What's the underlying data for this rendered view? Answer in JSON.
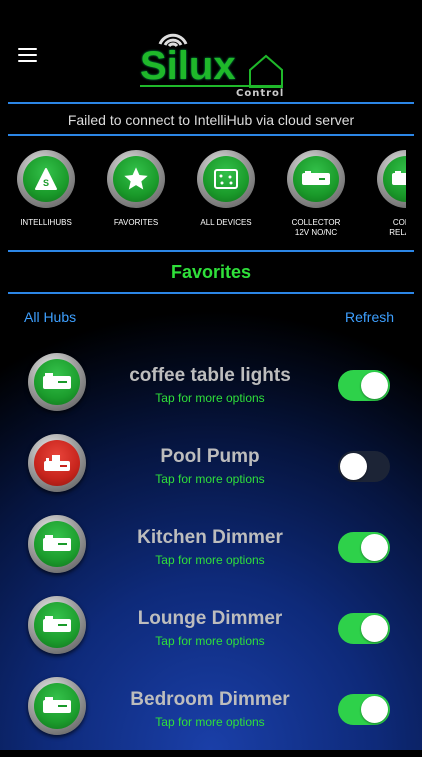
{
  "header": {
    "logo_word": "Silux",
    "logo_sub": "Control",
    "status_message": "Failed to connect to IntelliHub via cloud server"
  },
  "categories": [
    {
      "label": "INTELLIHUBS",
      "icon": "intellihub-icon"
    },
    {
      "label": "FAVORITES",
      "icon": "star-icon"
    },
    {
      "label": "ALL DEVICES",
      "icon": "all-devices-icon"
    },
    {
      "label": "COLLECTOR\n12V NO/NC",
      "icon": "collector-device-icon"
    },
    {
      "label": "COLLE\nRELAY C",
      "icon": "relay-device-icon"
    }
  ],
  "favorites": {
    "title": "Favorites",
    "all_hubs": "All Hubs",
    "refresh": "Refresh"
  },
  "devices": [
    {
      "name": "coffee table lights",
      "sub": "Tap for more options",
      "on": true,
      "state_color": "green",
      "icon": "dimmer-device-icon"
    },
    {
      "name": "Pool Pump",
      "sub": "Tap for more options",
      "on": false,
      "state_color": "red",
      "icon": "pump-device-icon"
    },
    {
      "name": "Kitchen Dimmer",
      "sub": "Tap for more options",
      "on": true,
      "state_color": "green",
      "icon": "dimmer-device-icon"
    },
    {
      "name": "Lounge Dimmer",
      "sub": "Tap for more options",
      "on": true,
      "state_color": "green",
      "icon": "dimmer-device-icon"
    },
    {
      "name": "Bedroom Dimmer",
      "sub": "Tap for more options",
      "on": true,
      "state_color": "green",
      "icon": "dimmer-device-icon"
    }
  ],
  "colors": {
    "accent_green": "#2fe03a",
    "link_blue": "#3ea0ff",
    "divider_blue": "#2c86e6"
  }
}
